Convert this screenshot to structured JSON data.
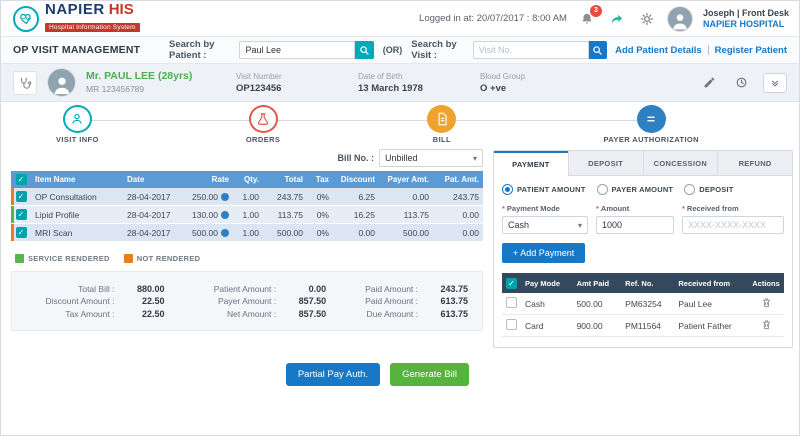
{
  "colors": {
    "accent_teal": "#00aab8",
    "accent_blue": "#1878c8",
    "table_header_blue": "#5b9bd5",
    "payment_header_navy": "#34495e",
    "active_step_amber": "#f0a22e",
    "payer_step_blue": "#2f80c3",
    "orders_step_red": "#e0584d",
    "rendered_green": "#58b44c",
    "not_rendered_orange": "#e67e22",
    "brand_navy": "#1c3e6e",
    "brand_red": "#c0392b",
    "patient_name_green": "#4caf50",
    "notification_badge_red": "#e74c3c",
    "generate_bill_green": "#56b33e"
  },
  "icons": {
    "check": "✓",
    "caret_down": "▾",
    "asterisk": "*"
  },
  "header": {
    "brand_name": "NAPIER",
    "brand_his": "HIS",
    "brand_tagline": "Hospital Information System",
    "logged_in": "Logged in at: 20/07/2017 : 8:00 AM",
    "notification_count": "3",
    "user_line": "Joseph | Front Desk",
    "hospital_name": "NAPIER HOSPITAL"
  },
  "toolbar": {
    "page_title": "OP VISIT MANAGEMENT",
    "search_patient_label": "Search by Patient :",
    "search_patient_value": "Paul Lee",
    "or_text": "(OR)",
    "search_visit_label": "Search by Visit :",
    "search_visit_placeholder": "Visit No.",
    "add_patient_link": "Add Patient Details",
    "register_patient_link": "Register Patient"
  },
  "patient": {
    "name": "Mr. PAUL LEE (28yrs)",
    "mr_number": "MR 123456789",
    "visit_number_label": "Visit Number",
    "visit_number": "OP123456",
    "dob_label": "Date of Birth",
    "dob": "13 March 1978",
    "blood_group_label": "Blood Group",
    "blood_group": "O +ve"
  },
  "steps": [
    {
      "label": "VISIT INFO"
    },
    {
      "label": "ORDERS"
    },
    {
      "label": "BILL"
    },
    {
      "label": "PAYER AUTHORIZATION"
    }
  ],
  "bill": {
    "bill_no_label": "Bill No. :",
    "bill_no_value": "Unbilled",
    "columns": [
      "Item Name",
      "Date",
      "Rate",
      "Qty.",
      "Total",
      "Tax",
      "Discount",
      "Payer Amt.",
      "Pat. Amt."
    ],
    "rows": [
      {
        "item": "OP Consultation",
        "date": "28-04-2017",
        "rate": "250.00",
        "qty": "1.00",
        "total": "243.75",
        "tax": "0%",
        "discount": "6.25",
        "payer_amt": "0.00",
        "pat_amt": "243.75",
        "status": "not-rendered"
      },
      {
        "item": "Lipid Profile",
        "date": "28-04-2017",
        "rate": "130.00",
        "qty": "1.00",
        "total": "113.75",
        "tax": "0%",
        "discount": "16.25",
        "payer_amt": "113.75",
        "pat_amt": "0.00",
        "status": "rendered"
      },
      {
        "item": "MRI Scan",
        "date": "28-04-2017",
        "rate": "500.00",
        "qty": "1.00",
        "total": "500.00",
        "tax": "0%",
        "discount": "0.00",
        "payer_amt": "500.00",
        "pat_amt": "0.00",
        "status": "not-rendered"
      }
    ],
    "legend": [
      {
        "label": "SERVICE RENDERED",
        "status": "rendered"
      },
      {
        "label": "NOT RENDERED",
        "status": "not-rendered"
      }
    ],
    "summary": {
      "col1": [
        {
          "label": "Total Bill :",
          "value": "880.00"
        },
        {
          "label": "Discount Amount :",
          "value": "22.50"
        },
        {
          "label": "Tax Amount :",
          "value": "22.50"
        }
      ],
      "col2": [
        {
          "label": "Patient Amount :",
          "value": "0.00"
        },
        {
          "label": "Payer Amount :",
          "value": "857.50"
        },
        {
          "label": "Net Amount :",
          "value": "857.50"
        }
      ],
      "col3": [
        {
          "label": "Paid Amount :",
          "value": "243.75"
        },
        {
          "label": "Paid Amount :",
          "value": "613.75"
        },
        {
          "label": "Due Amount :",
          "value": "613.75"
        }
      ]
    }
  },
  "actions": {
    "partial_pay_label": "Partial Pay Auth.",
    "generate_bill_label": "Generate Bill"
  },
  "payment": {
    "tabs": [
      {
        "label": "PAYMENT"
      },
      {
        "label": "DEPOSIT"
      },
      {
        "label": "CONCESSION"
      },
      {
        "label": "REFUND"
      }
    ],
    "radios": [
      {
        "label": "PATIENT AMOUNT"
      },
      {
        "label": "PAYER AMOUNT"
      },
      {
        "label": "DEPOSIT"
      }
    ],
    "payment_mode_label": "Payment Mode",
    "payment_mode_value": "Cash",
    "amount_label": "Amount",
    "amount_value": "1000",
    "received_from_label": "Received from",
    "received_from_placeholder": "XXXX-XXXX-XXXX",
    "add_payment_label": "+ Add Payment",
    "columns": [
      "Pay Mode",
      "Amt Paid",
      "Ref. No.",
      "Received from",
      "Actions"
    ],
    "rows": [
      {
        "mode": "Cash",
        "amount": "500.00",
        "ref": "PM63254",
        "from": "Paul Lee"
      },
      {
        "mode": "Card",
        "amount": "900.00",
        "ref": "PM11564",
        "from": "Patient Father"
      }
    ]
  }
}
